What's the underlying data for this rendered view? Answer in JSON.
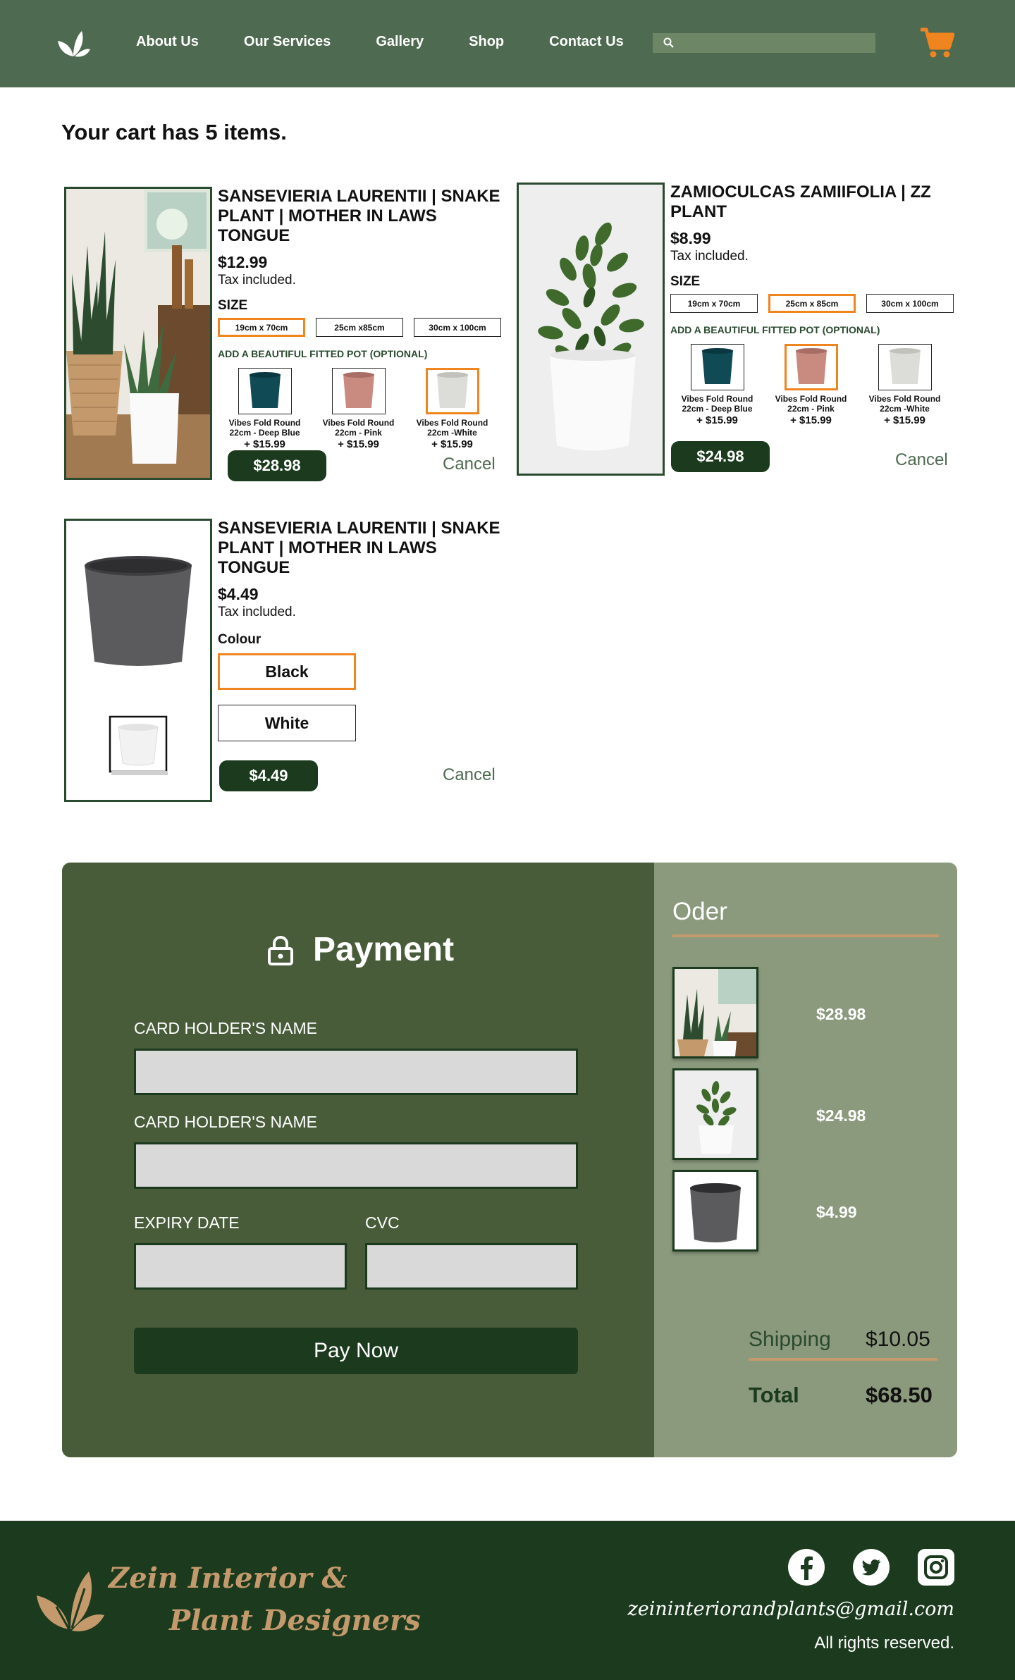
{
  "nav": {
    "items": [
      "About Us",
      "Our Services",
      "Gallery",
      "Shop",
      "Contact Us"
    ],
    "search_placeholder": ""
  },
  "cart": {
    "heading": "Your cart has 5 items."
  },
  "products": [
    {
      "title": "SANSEVIERIA LAURENTII | SNAKE PLANT | MOTHER IN LAWS TONGUE",
      "price": "$12.99",
      "tax": "Tax included.",
      "size_label": "SIZE",
      "sizes": [
        "19cm x 70cm",
        "25cm x85cm",
        "30cm x 100cm"
      ],
      "selected_size": 0,
      "pot_label": "ADD A BEAUTIFUL FITTED POT (OPTIONAL)",
      "pots": [
        {
          "name": "Vibes Fold Round 22cm - Deep Blue",
          "price": "+ $15.99",
          "color": "#0f4a55"
        },
        {
          "name": "Vibes Fold Round 22cm - Pink",
          "price": "+ $15.99",
          "color": "#c98a80"
        },
        {
          "name": "Vibes Fold Round 22cm -White",
          "price": "+ $15.99",
          "color": "#dcdcd8"
        }
      ],
      "selected_pot": 2,
      "total": "$28.98",
      "cancel": "Cancel"
    },
    {
      "title": "ZAMIOCULCAS ZAMIIFOLIA | ZZ PLANT",
      "price": "$8.99",
      "tax": "Tax included.",
      "size_label": "SIZE",
      "sizes": [
        "19cm x 70cm",
        "25cm x 85cm",
        "30cm x 100cm"
      ],
      "selected_size": 1,
      "pot_label": "ADD A BEAUTIFUL FITTED POT (OPTIONAL)",
      "pots": [
        {
          "name": "Vibes Fold Round 22cm - Deep Blue",
          "price": "+ $15.99",
          "color": "#0f4a55"
        },
        {
          "name": "Vibes Fold Round 22cm - Pink",
          "price": "+ $15.99",
          "color": "#c98a80"
        },
        {
          "name": "Vibes Fold Round 22cm -White",
          "price": "+ $15.99",
          "color": "#dcdcd8"
        }
      ],
      "selected_pot": 1,
      "total": "$24.98",
      "cancel": "Cancel"
    },
    {
      "title": "SANSEVIERIA LAURENTII | SNAKE PLANT | MOTHER IN LAWS TONGUE",
      "price": "$4.49",
      "tax": "Tax included.",
      "colour_label": "Colour",
      "colours": [
        "Black",
        "White"
      ],
      "selected_colour": 0,
      "total": "$4.49",
      "cancel": "Cancel"
    }
  ],
  "payment": {
    "title": "Payment",
    "field1_label": "CARD HOLDER'S NAME",
    "field2_label": "CARD HOLDER'S NAME",
    "expiry_label": "EXPIRY DATE",
    "cvc_label": "CVC",
    "pay_button": "Pay Now"
  },
  "order": {
    "title": "Oder",
    "items": [
      {
        "price": "$28.98"
      },
      {
        "price": "$24.98"
      },
      {
        "price": "$4.99"
      }
    ],
    "shipping_label": "Shipping",
    "shipping_value": "$10.05",
    "total_label": "Total",
    "total_value": "$68.50"
  },
  "footer": {
    "brand_line1": "Zein Interior &",
    "brand_line2": "Plant Designers",
    "email": "zeininteriorandplants@gmail.com",
    "rights": "All rights reserved.",
    "social": [
      "facebook-icon",
      "twitter-icon",
      "instagram-icon"
    ]
  },
  "colors": {
    "nav_bg": "#4e6a50",
    "dark_green": "#1b3a1e",
    "accent_orange": "#f0841e",
    "payment_bg": "#485c3a",
    "order_bg": "#8b9a7d",
    "tan": "#c49a6c"
  }
}
